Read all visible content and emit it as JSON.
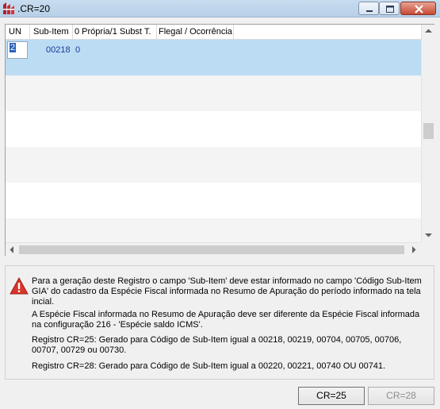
{
  "window": {
    "title": ".CR=20",
    "controls": [
      "minimize-icon",
      "maximize-icon",
      "close-icon"
    ]
  },
  "grid": {
    "columns": [
      "UN",
      "Sub-Item",
      "0 Própria/1 Subst T.",
      "Flegal / Ocorrência"
    ],
    "rows": [
      {
        "un": "2",
        "sub_item": "00218",
        "propria": "0",
        "flegal": "",
        "selected": true
      }
    ]
  },
  "message": {
    "icon": "warning-icon",
    "paragraphs": [
      "Para a geração deste Registro o campo 'Sub-Item' deve estar informado no campo 'Código Sub-Item GIA' do cadastro da Espécie Fiscal informada no Resumo de Apuração do período informado na tela incial.",
      "A Espécie Fiscal informada no Resumo de Apuração deve ser diferente da Espécie Fiscal informada na configuração 216 - 'Espécie saldo ICMS'.",
      "Registro CR=25: Gerado para Código de Sub-Item igual a 00218, 00219, 00704, 00705, 00706, 00707, 00729 ou 00730.",
      "Registro CR=28: Gerado para Código de Sub-Item igual a 00220, 00221, 00740 OU 00741."
    ]
  },
  "buttons": {
    "cr25": {
      "label": "CR=25",
      "enabled": true
    },
    "cr28": {
      "label": "CR=28",
      "enabled": false
    }
  },
  "colors": {
    "selected_row": "#bcdcf4",
    "cell_text": "#1a3a9a",
    "warning": "#d9342b"
  }
}
